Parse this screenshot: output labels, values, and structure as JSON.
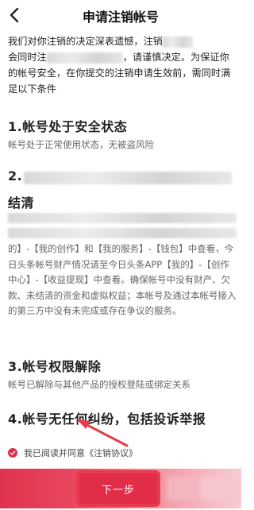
{
  "nav": {
    "title": "申请注销帐号"
  },
  "intro": {
    "part1": "我们对你注销的决定深表遗憾，注销",
    "part2": "会同时注",
    "part3": "，请谨慎决定。为保证你的帐号安全，在你提交的注销申请生效前，需同时满足以下条件"
  },
  "sections": [
    {
      "title": "1.帐号处于安全状态",
      "desc": "帐号处于正常使用状态，无被盗风险"
    },
    {
      "title_prefix": "2.",
      "title_suffix": "结清",
      "body": "的】-【我的创作】和【我的服务】-【钱包】中查看，今日头条帐号财产情况请至今日头条APP【我的】-【创作中心】-【收益提现】中查看。确保帐号中没有财产、欠款、未结清的资金和虚拟权益；本帐号及通过本帐号接入的第三方中没有未完成或存在争议的服务。"
    },
    {
      "title": "3.帐号权限解除",
      "desc": "帐号已解除与其他产品的授权登陆或绑定关系"
    },
    {
      "title": "4.帐号无任何纠纷，包括投诉举报"
    }
  ],
  "agreement": {
    "label": "我已阅读并同意",
    "link": "《注销协议》"
  },
  "next_button": {
    "label": "下一步"
  },
  "colors": {
    "accent": "#e22d49",
    "annotation": "#e53b4d"
  }
}
